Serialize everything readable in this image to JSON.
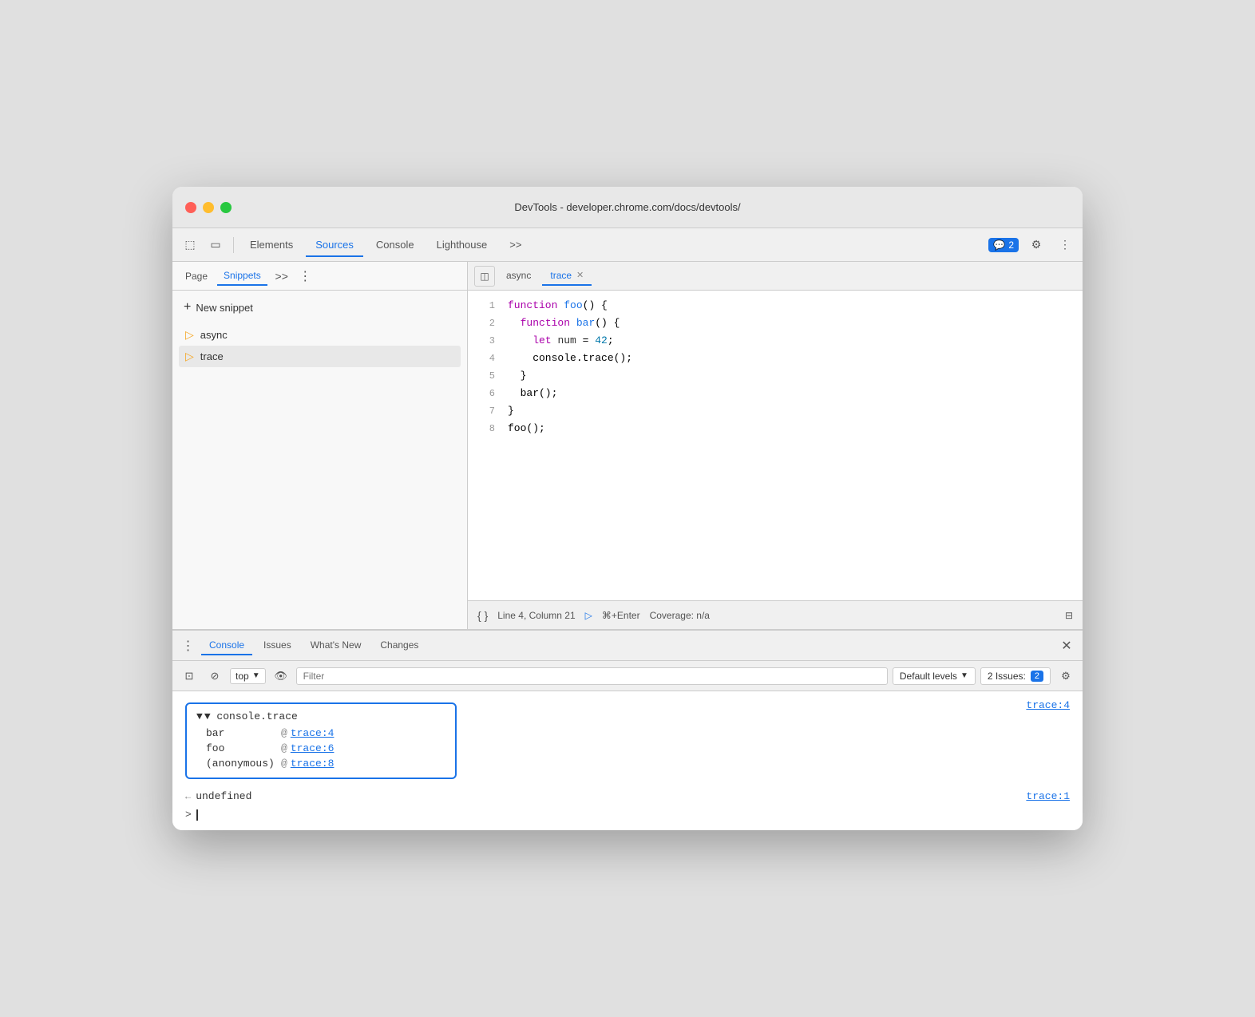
{
  "window": {
    "title": "DevTools - developer.chrome.com/docs/devtools/"
  },
  "traffic_lights": {
    "red": "#ff5f57",
    "yellow": "#ffbd2e",
    "green": "#28c840"
  },
  "main_toolbar": {
    "tabs": [
      {
        "id": "elements",
        "label": "Elements",
        "active": false
      },
      {
        "id": "sources",
        "label": "Sources",
        "active": true
      },
      {
        "id": "console",
        "label": "Console",
        "active": false
      },
      {
        "id": "lighthouse",
        "label": "Lighthouse",
        "active": false
      }
    ],
    "issues_count": "2",
    "more_tabs_label": ">>"
  },
  "sidebar": {
    "tabs": [
      {
        "id": "page",
        "label": "Page",
        "active": false
      },
      {
        "id": "snippets",
        "label": "Snippets",
        "active": true
      }
    ],
    "new_snippet_label": "New snippet",
    "snippets": [
      {
        "id": "async",
        "label": "async",
        "active": false
      },
      {
        "id": "trace",
        "label": "trace",
        "active": true
      }
    ]
  },
  "editor": {
    "tabs": [
      {
        "id": "async",
        "label": "async",
        "active": false,
        "closeable": false
      },
      {
        "id": "trace",
        "label": "trace",
        "active": true,
        "closeable": true
      }
    ],
    "code": [
      {
        "line": 1,
        "content": "function foo() {"
      },
      {
        "line": 2,
        "content": "  function bar() {"
      },
      {
        "line": 3,
        "content": "    let num = 42;"
      },
      {
        "line": 4,
        "content": "    console.trace();"
      },
      {
        "line": 5,
        "content": "  }"
      },
      {
        "line": 6,
        "content": "  bar();"
      },
      {
        "line": 7,
        "content": "}"
      },
      {
        "line": 8,
        "content": "foo();"
      }
    ],
    "status": {
      "position": "Line 4, Column 21",
      "coverage": "Coverage: n/a",
      "run_label": "⌘+Enter"
    }
  },
  "bottom_panel": {
    "tabs": [
      {
        "id": "console",
        "label": "Console",
        "active": true
      },
      {
        "id": "issues",
        "label": "Issues",
        "active": false
      },
      {
        "id": "whats_new",
        "label": "What's New",
        "active": false
      },
      {
        "id": "changes",
        "label": "Changes",
        "active": false
      }
    ]
  },
  "console_toolbar": {
    "top_label": "top",
    "filter_placeholder": "Filter",
    "levels_label": "Default levels",
    "issues_count": "2 Issues:",
    "issues_badge": "2"
  },
  "console_output": {
    "trace_header": "▼ console.trace",
    "trace_location": "trace:4",
    "trace_rows": [
      {
        "fn": "bar",
        "at": "@",
        "link": "trace:4"
      },
      {
        "fn": "foo",
        "at": "@",
        "link": "trace:6"
      },
      {
        "fn": "(anonymous)",
        "at": "@",
        "link": "trace:8"
      }
    ],
    "undefined_arrow": "←",
    "undefined_text": "undefined",
    "undefined_location": "trace:1",
    "prompt_symbol": ">",
    "prompt_cursor": "|"
  }
}
